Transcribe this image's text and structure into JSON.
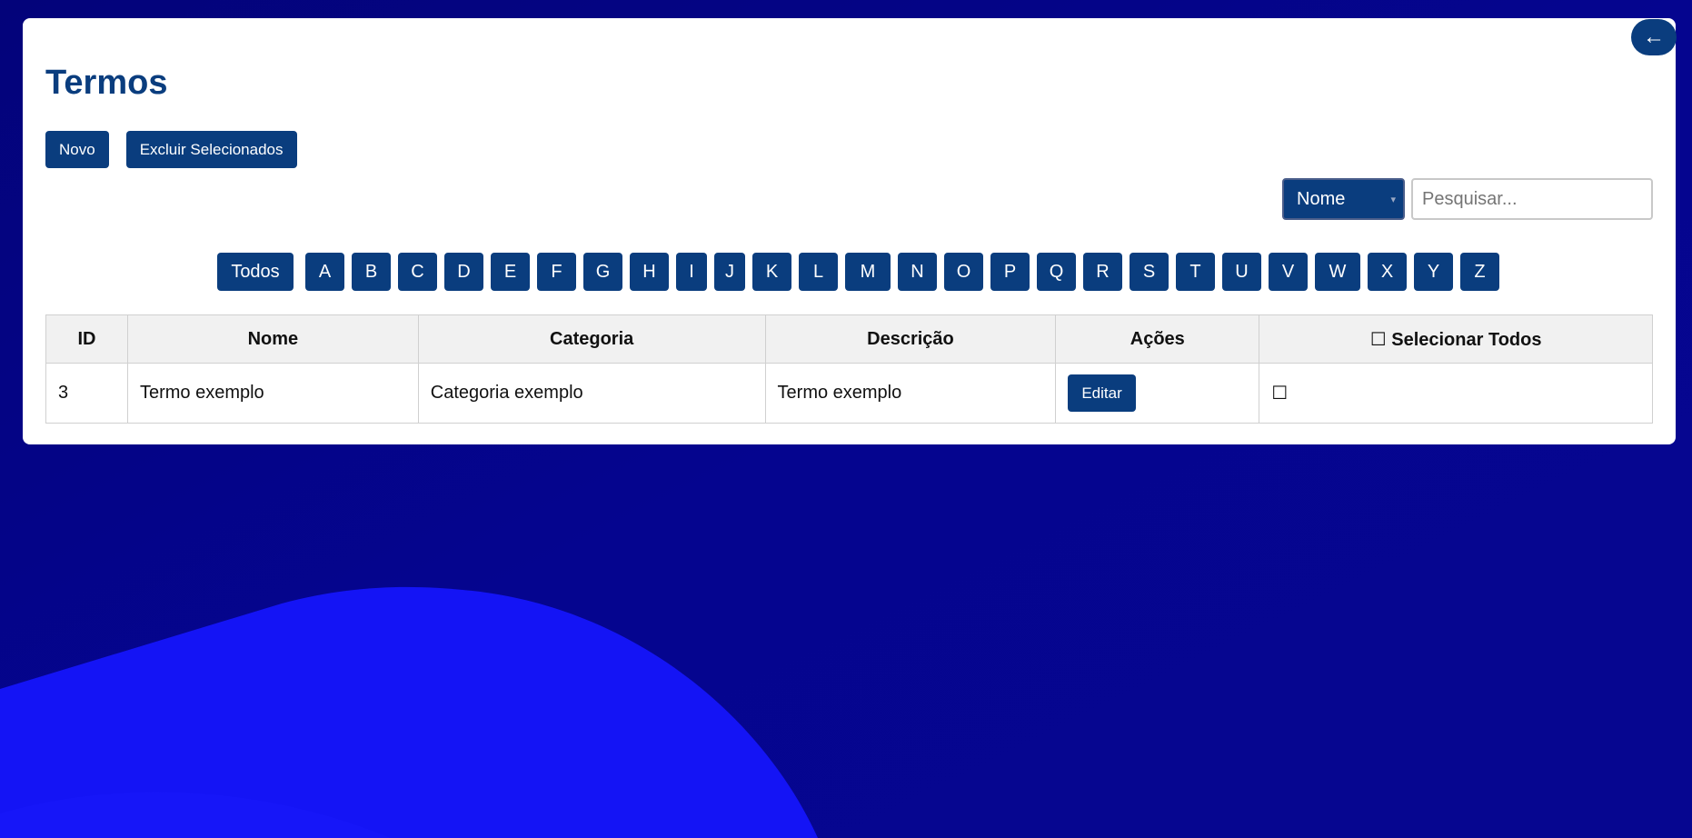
{
  "page": {
    "title": "Termos",
    "back_icon": "arrow-left-icon",
    "back_glyph": "←"
  },
  "colors": {
    "background": "#05058c",
    "accent": "#1414f5",
    "primary": "#0a3d7e",
    "card": "#ffffff"
  },
  "toolbar": {
    "new_label": "Novo",
    "delete_selected_label": "Excluir Selecionados"
  },
  "search": {
    "field_selected": "Nome",
    "placeholder": "Pesquisar..."
  },
  "filter": {
    "all_label": "Todos",
    "letters": [
      "A",
      "B",
      "C",
      "D",
      "E",
      "F",
      "G",
      "H",
      "I",
      "J",
      "K",
      "L",
      "M",
      "N",
      "O",
      "P",
      "Q",
      "R",
      "S",
      "T",
      "U",
      "V",
      "W",
      "X",
      "Y",
      "Z"
    ]
  },
  "table": {
    "headers": {
      "id": "ID",
      "name": "Nome",
      "category": "Categoria",
      "description": "Descrição",
      "actions": "Ações",
      "select_all": "☐ Selecionar Todos"
    },
    "rows": [
      {
        "id": "3",
        "name": "Termo exemplo",
        "category": "Categoria exemplo",
        "description": "Termo exemplo",
        "edit_label": "Editar",
        "checkbox": "☐"
      }
    ]
  }
}
